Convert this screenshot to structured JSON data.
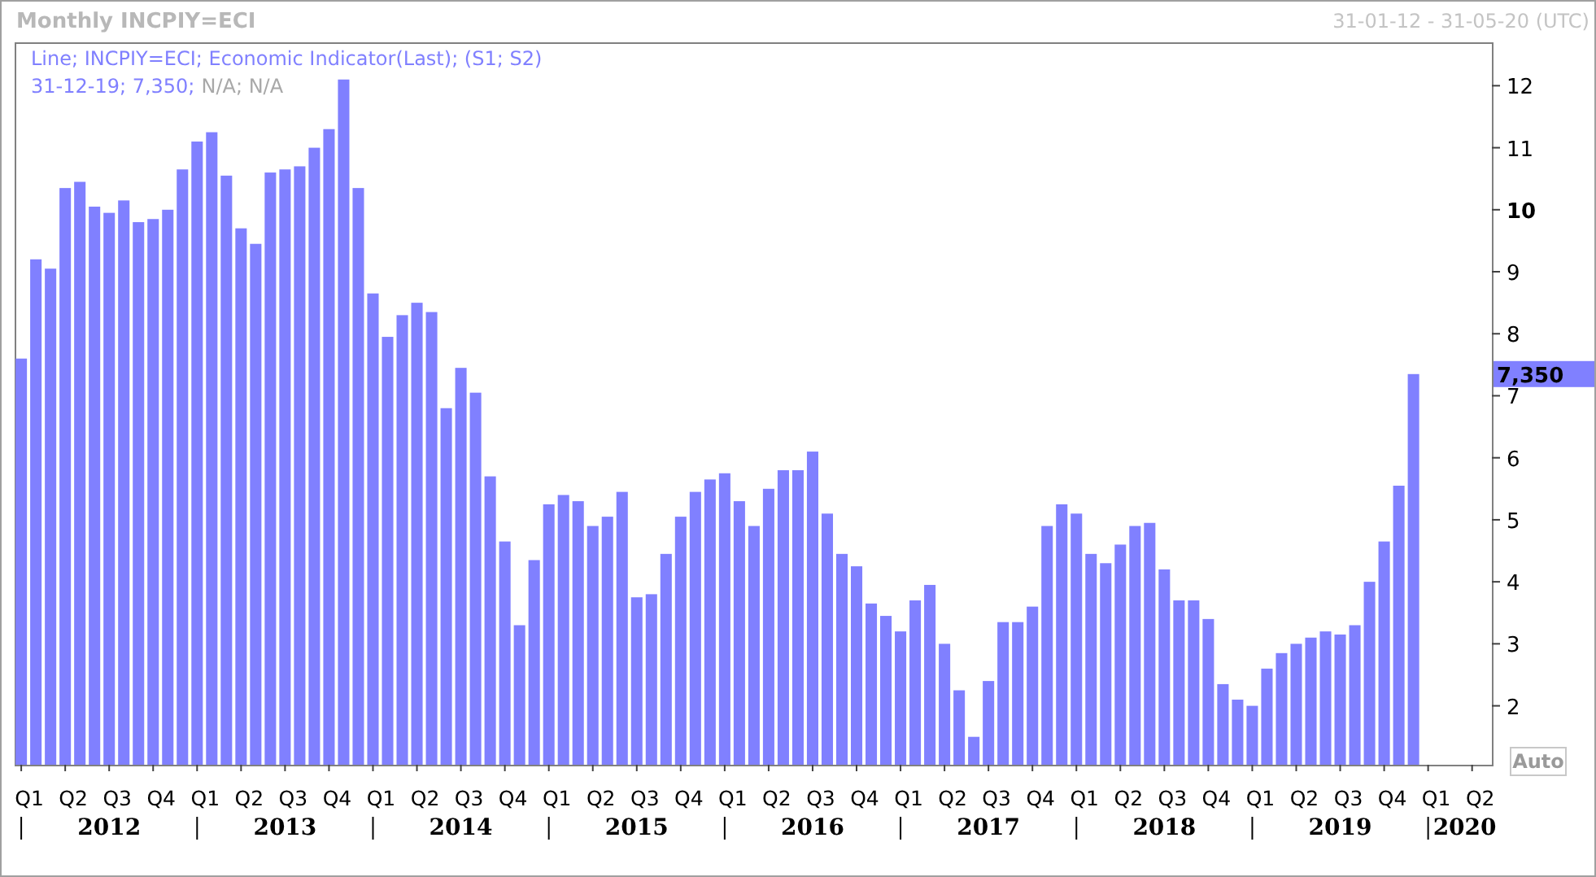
{
  "header": {
    "title": "Monthly INCPIY=ECI",
    "range": "31-01-12 - 31-05-20 (UTC)"
  },
  "legend": {
    "series_line": "Line; INCPIY=ECI; Economic Indicator(Last); (S1; S2)",
    "value_parts": [
      {
        "text": "31-12-19; 7,350;",
        "kind": "value"
      },
      {
        "text": "N/A; N/A",
        "kind": "missing"
      }
    ]
  },
  "last_value_label": "7,350",
  "auto_button": "Auto",
  "y_tick_bold": [
    false,
    false,
    false,
    false,
    false,
    false,
    false,
    false,
    true,
    false,
    false
  ],
  "chart_data": {
    "type": "bar",
    "ylim": [
      1.05,
      12.7
    ],
    "categories": [
      "Q1",
      null,
      null,
      "Q2",
      null,
      null,
      "Q3",
      null,
      null,
      "Q4",
      null,
      null,
      "Q1",
      null,
      null,
      "Q2",
      null,
      null,
      "Q3",
      null,
      null,
      "Q4",
      null,
      null,
      "Q1",
      null,
      null,
      "Q2",
      null,
      null,
      "Q3",
      null,
      null,
      "Q4",
      null,
      null,
      "Q1",
      null,
      null,
      "Q2",
      null,
      null,
      "Q3",
      null,
      null,
      "Q4",
      null,
      null,
      "Q1",
      null,
      null,
      "Q2",
      null,
      null,
      "Q3",
      null,
      null,
      "Q4",
      null,
      null,
      "Q1",
      null,
      null,
      "Q2",
      null,
      null,
      "Q3",
      null,
      null,
      "Q4",
      null,
      null,
      "Q1",
      null,
      null,
      "Q2",
      null,
      null,
      "Q3",
      null,
      null,
      "Q4",
      null,
      null,
      "Q1",
      null,
      null,
      "Q2",
      null,
      null,
      "Q3",
      null,
      null,
      "Q4",
      null,
      null,
      "Q1",
      null,
      null,
      "Q2",
      null
    ],
    "series": [
      {
        "color": "#8080ff",
        "values": [
          7.6,
          9.2,
          9.05,
          10.35,
          10.45,
          10.05,
          9.95,
          10.15,
          9.8,
          9.85,
          10.0,
          10.65,
          11.1,
          11.25,
          10.55,
          9.7,
          9.45,
          10.6,
          10.65,
          10.7,
          11.0,
          11.3,
          12.1,
          10.35,
          8.65,
          7.95,
          8.3,
          8.5,
          8.35,
          6.8,
          7.45,
          7.05,
          5.7,
          4.65,
          3.3,
          4.35,
          5.25,
          5.4,
          5.3,
          4.9,
          5.05,
          5.45,
          3.75,
          3.8,
          4.45,
          5.05,
          5.45,
          5.65,
          5.75,
          5.3,
          4.9,
          5.5,
          5.8,
          5.8,
          6.1,
          5.1,
          4.45,
          4.25,
          3.65,
          3.45,
          3.2,
          3.7,
          3.95,
          3.0,
          2.25,
          1.5,
          2.4,
          3.35,
          3.35,
          3.6,
          4.9,
          5.25,
          5.1,
          4.45,
          4.3,
          4.6,
          4.9,
          4.95,
          4.2,
          3.7,
          3.7,
          3.4,
          2.35,
          2.1,
          2.0,
          2.6,
          2.85,
          3.0,
          3.1,
          3.2,
          3.15,
          3.3,
          4.0,
          4.65,
          5.55,
          7.35,
          null,
          null,
          null,
          null,
          null
        ]
      }
    ],
    "yticks": [
      2,
      3,
      4,
      5,
      6,
      7,
      8,
      9,
      10,
      11,
      12
    ]
  },
  "year_labels": [
    {
      "label": "2012"
    },
    {
      "label": "2013"
    },
    {
      "label": "2014"
    },
    {
      "label": "2015"
    },
    {
      "label": "2016"
    },
    {
      "label": "2017"
    },
    {
      "label": "2018"
    },
    {
      "label": "2019"
    },
    {
      "label": "2020"
    }
  ]
}
